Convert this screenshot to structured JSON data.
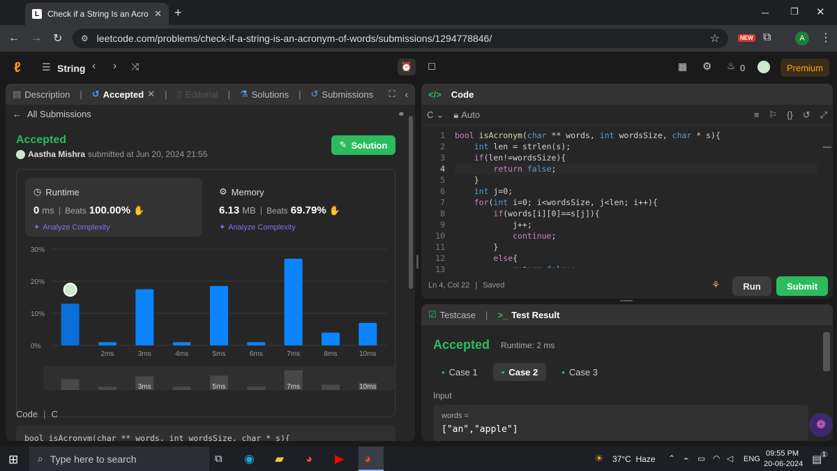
{
  "browser": {
    "tab_title": "Check if a String Is an Acronym",
    "url": "leetcode.com/problems/check-if-a-string-is-an-acronym-of-words/submissions/1294778846/",
    "new_badge": "NEW",
    "profile_initial": "A"
  },
  "nav": {
    "list_label": "String",
    "streak": "0",
    "premium": "Premium"
  },
  "left_tabs": {
    "description": "Description",
    "accepted": "Accepted",
    "editorial": "Editorial",
    "solutions": "Solutions",
    "submissions": "Submissions"
  },
  "submission": {
    "back_label": "All Submissions",
    "status": "Accepted",
    "user": "Aastha Mishra",
    "submitted_at": "submitted at Jun 20, 2024 21:55",
    "solution_btn": "Solution",
    "runtime_label": "Runtime",
    "runtime_value": "0",
    "runtime_unit": "ms",
    "runtime_beats_label": "Beats",
    "runtime_beats": "100.00%",
    "memory_label": "Memory",
    "memory_value": "6.13",
    "memory_unit": "MB",
    "memory_beats_label": "Beats",
    "memory_beats": "69.79%",
    "analyze": "Analyze Complexity",
    "code_label": "Code",
    "code_lang": "C",
    "code_preview": "bool isAcronym(char ** words, int wordsSize, char * s){"
  },
  "chart_data": {
    "type": "bar",
    "categories": [
      "",
      "2ms",
      "3ms",
      "4ms",
      "5ms",
      "6ms",
      "7ms",
      "8ms",
      "10ms"
    ],
    "values": [
      13,
      1,
      17.5,
      1,
      18.5,
      1,
      27,
      4,
      7
    ],
    "ylim": [
      0,
      30
    ],
    "yticks": [
      "30%",
      "20%",
      "10%",
      "0%"
    ],
    "mini_labels": [
      "3ms",
      "5ms",
      "7ms",
      "10ms"
    ],
    "grid": true
  },
  "editor": {
    "title": "Code",
    "lang": "C",
    "mode": "Auto",
    "status": "Ln 4, Col 22",
    "saved": "Saved",
    "run": "Run",
    "submit": "Submit",
    "line_numbers": [
      "1",
      "2",
      "3",
      "4",
      "5",
      "6",
      "7",
      "8",
      "9",
      "10",
      "11",
      "12",
      "13"
    ]
  },
  "testpanel": {
    "testcase_tab": "Testcase",
    "result_tab": "Test Result",
    "status": "Accepted",
    "runtime": "Runtime: 2 ms",
    "cases": [
      "Case 1",
      "Case 2",
      "Case 3"
    ],
    "input_label": "Input",
    "var_name": "words =",
    "var_value": "[\"an\",\"apple\"]"
  },
  "taskbar": {
    "search_placeholder": "Type here to search",
    "weather": "37°C  Haze",
    "lang": "ENG",
    "time": "09:55 PM",
    "date": "20-06-2024",
    "notif": "1"
  },
  "colors": {
    "green": "#2cbb5d",
    "bar": "#0a84ff",
    "bar_first": "#0a6fd6",
    "bg": "#1a1a1a",
    "panel": "#262626"
  }
}
